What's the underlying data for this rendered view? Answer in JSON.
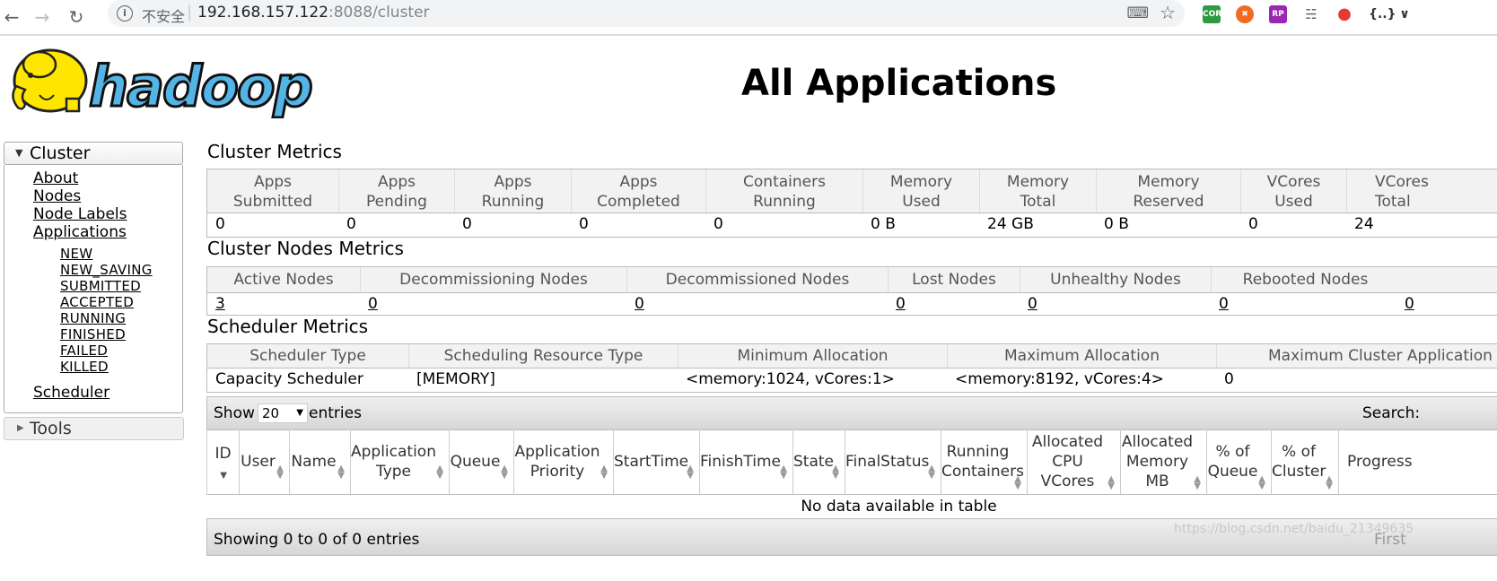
{
  "browser": {
    "security_label": "不安全",
    "url_host": "192.168.157.122",
    "url_rest": ":8088/cluster",
    "ext_cors": "CORS",
    "ext_rp": "RP",
    "ext_json": "{..}"
  },
  "page": {
    "title": "All Applications",
    "logo_text": "hadoop"
  },
  "sidebar": {
    "cluster_label": "Cluster",
    "links": [
      "About",
      "Nodes",
      "Node Labels",
      "Applications"
    ],
    "app_states": [
      "NEW",
      "NEW_SAVING",
      "SUBMITTED",
      "ACCEPTED",
      "RUNNING",
      "FINISHED",
      "FAILED",
      "KILLED"
    ],
    "scheduler": "Scheduler",
    "tools_label": "Tools"
  },
  "cluster_metrics": {
    "title": "Cluster Metrics",
    "headers": [
      [
        "Apps",
        "Submitted"
      ],
      [
        "Apps",
        "Pending"
      ],
      [
        "Apps",
        "Running"
      ],
      [
        "Apps",
        "Completed"
      ],
      [
        "Containers",
        "Running"
      ],
      [
        "Memory",
        "Used"
      ],
      [
        "Memory",
        "Total"
      ],
      [
        "Memory",
        "Reserved"
      ],
      [
        "VCores",
        "Used"
      ],
      [
        "VCores",
        "Total"
      ]
    ],
    "values": [
      "0",
      "0",
      "0",
      "0",
      "0",
      "0 B",
      "24 GB",
      "0 B",
      "0",
      "24"
    ]
  },
  "nodes_metrics": {
    "title": "Cluster Nodes Metrics",
    "headers": [
      "Active Nodes",
      "Decommissioning Nodes",
      "Decommissioned Nodes",
      "Lost Nodes",
      "Unhealthy Nodes",
      "Rebooted Nodes"
    ],
    "values": [
      "3",
      "0",
      "0",
      "0",
      "0",
      "0",
      "0"
    ]
  },
  "scheduler_metrics": {
    "title": "Scheduler Metrics",
    "headers": [
      "Scheduler Type",
      "Scheduling Resource Type",
      "Minimum Allocation",
      "Maximum Allocation",
      "Maximum Cluster Application Priority"
    ],
    "values": [
      "Capacity Scheduler",
      "[MEMORY]",
      "<memory:1024, vCores:1>",
      "<memory:8192, vCores:4>",
      "0"
    ]
  },
  "apps_table": {
    "show_label": "Show",
    "page_size": "20",
    "entries_label": "entries",
    "search_label": "Search:",
    "columns": [
      [
        "ID"
      ],
      [
        "User"
      ],
      [
        "Name"
      ],
      [
        "Application",
        "Type"
      ],
      [
        "Queue"
      ],
      [
        "Application",
        "Priority"
      ],
      [
        "StartTime"
      ],
      [
        "FinishTime"
      ],
      [
        "State"
      ],
      [
        "FinalStatus"
      ],
      [
        "Running",
        "Containers"
      ],
      [
        "Allocated",
        "CPU",
        "VCores"
      ],
      [
        "Allocated",
        "Memory",
        "MB"
      ],
      [
        "% of",
        "Queue"
      ],
      [
        "% of",
        "Cluster"
      ],
      [
        "Progress"
      ]
    ],
    "empty_message": "No data available in table",
    "info": "Showing 0 to 0 of 0 entries",
    "first_label": "First"
  },
  "watermark": "https://blog.csdn.net/baidu_21349635"
}
